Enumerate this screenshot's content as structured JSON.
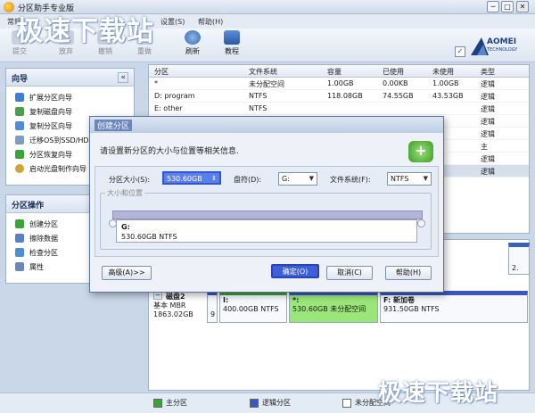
{
  "window": {
    "title": "分区助手专业版",
    "minimize": "─",
    "maximize": "□",
    "close": "✕"
  },
  "menu": [
    "常规",
    "设置(S)",
    "帮助(H)"
  ],
  "toolbar": {
    "items": [
      {
        "label": "提交",
        "icon": "submit-icon",
        "enabled": false
      },
      {
        "label": "放弃",
        "icon": "discard-icon",
        "enabled": false
      },
      {
        "label": "撤销",
        "icon": "undo-icon",
        "enabled": false
      },
      {
        "label": "重做",
        "icon": "redo-icon",
        "enabled": false
      },
      {
        "label": "刷新",
        "icon": "refresh-icon",
        "enabled": true
      },
      {
        "label": "教程",
        "icon": "tutorial-icon",
        "enabled": true
      }
    ],
    "logo_text": "AOMEI",
    "logo_sub": "TECHNOLOGY",
    "settings_glyph": "✓"
  },
  "wizards": {
    "header": "向导",
    "collapse": "«",
    "items": [
      "扩展分区向导",
      "复制磁盘向导",
      "复制分区向导",
      "迁移OS到SSD/HDD",
      "分区恢复向导",
      "启动光盘制作向导"
    ]
  },
  "operations": {
    "header": "分区操作",
    "items": [
      "创建分区",
      "擦除数据",
      "检查分区",
      "属性"
    ]
  },
  "table": {
    "headers": [
      "分区",
      "文件系统",
      "容量",
      "已使用",
      "未使用",
      "类型"
    ],
    "rows": [
      {
        "name": "*",
        "fs": "未分配空间",
        "cap": "1.00GB",
        "used": "0.00KB",
        "free": "1.00GB",
        "type": "逻辑"
      },
      {
        "name": "D: program",
        "fs": "NTFS",
        "cap": "118.08GB",
        "used": "74.55GB",
        "free": "43.53GB",
        "type": "逻辑"
      },
      {
        "name": "E: other",
        "fs": "NTFS",
        "cap": "",
        "used": "",
        "free": "",
        "type": "逻辑"
      },
      {
        "name": "",
        "fs": "",
        "cap": "",
        "used": "",
        "free": "",
        "type": "逻辑"
      },
      {
        "name": "",
        "fs": "",
        "cap": "",
        "used": "",
        "free": "MB",
        "type": "逻辑"
      },
      {
        "name": "",
        "fs": "",
        "cap": "",
        "used": "",
        "free": "GB",
        "type": "主"
      },
      {
        "name": "",
        "fs": "",
        "cap": "",
        "used": "",
        "free": "GB",
        "type": "逻辑"
      },
      {
        "name": "",
        "fs": "",
        "cap": "",
        "used": "",
        "free": "GB",
        "type": "逻辑"
      }
    ]
  },
  "disk2": {
    "name": "磁盘2",
    "type": "基本 MBR",
    "size": "1863.02GB",
    "small_label": "9",
    "parts": [
      {
        "letter": "I:",
        "desc": "400.00GB NTFS"
      },
      {
        "letter": "*:",
        "desc": "530.60GB 未分配空间"
      },
      {
        "letter": "F: 新加卷",
        "desc": "931.50GB NTFS"
      }
    ],
    "right_stub": "2."
  },
  "legend": [
    "主分区",
    "逻辑分区",
    "未分配空间"
  ],
  "dialog": {
    "title": "创建分区",
    "desc": "请设置新分区的大小与位置等相关信息.",
    "size_label": "分区大小(S):",
    "size_value": "530.60GB",
    "drive_label": "盘符(D):",
    "drive_value": "G:",
    "fs_label": "文件系统(F):",
    "fs_value": "NTFS",
    "group_label": "大小和位置",
    "part_letter": "G:",
    "part_desc": "530.60GB NTFS",
    "advanced": "高级(A)>>",
    "ok": "确定(O)",
    "cancel": "取消(C)",
    "help": "帮助(H)"
  },
  "watermark": "极速下载站",
  "colors": {
    "accent": "#3a5fb5",
    "primary": "#3aa43a",
    "logical": "#3b55c5",
    "unallocated_sel": "#9be67b"
  }
}
